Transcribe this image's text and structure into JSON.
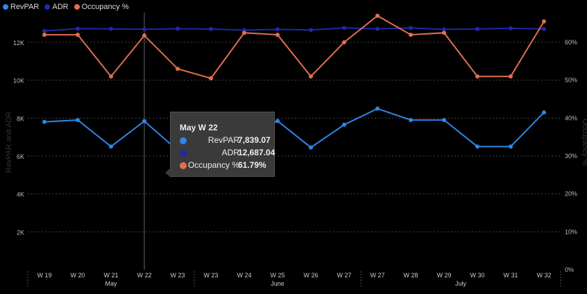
{
  "legend": [
    {
      "name": "RevPAR",
      "color": "#2f86e6"
    },
    {
      "name": "ADR",
      "color": "#1c2aa8"
    },
    {
      "name": "Occupancy %",
      "color": "#e06f4f"
    }
  ],
  "chart_data": {
    "type": "line",
    "categories": [
      "W 19",
      "W 20",
      "W 21",
      "W 22",
      "W 23",
      "W 23",
      "W 24",
      "W 25",
      "W 26",
      "W 27",
      "W 27",
      "W 28",
      "W 29",
      "W 30",
      "W 31",
      "W 32"
    ],
    "months": [
      {
        "label": "May",
        "start": 0,
        "end": 5
      },
      {
        "label": "June",
        "start": 5,
        "end": 10
      },
      {
        "label": "July",
        "start": 10,
        "end": 16
      }
    ],
    "ylabel": "RevPAR and ADR",
    "y2label": "Occupancy %",
    "ylim": [
      0,
      13500
    ],
    "y2lim": [
      0,
      0.675
    ],
    "yticks": [
      {
        "value": 2000,
        "label": "2K"
      },
      {
        "value": 4000,
        "label": "4K"
      },
      {
        "value": 6000,
        "label": "6K"
      },
      {
        "value": 8000,
        "label": "8K"
      },
      {
        "value": 10000,
        "label": "10K"
      },
      {
        "value": 12000,
        "label": "12K"
      }
    ],
    "y2ticks": [
      {
        "value": 0,
        "label": "0%"
      },
      {
        "value": 0.1,
        "label": "10%"
      },
      {
        "value": 0.2,
        "label": "20%"
      },
      {
        "value": 0.3,
        "label": "30%"
      },
      {
        "value": 0.4,
        "label": "40%"
      },
      {
        "value": 0.5,
        "label": "50%"
      },
      {
        "value": 0.6,
        "label": "60%"
      }
    ],
    "grid": true,
    "series": [
      {
        "name": "RevPAR",
        "axis": "left",
        "color": "#2f86e6",
        "values": [
          7800,
          7900,
          6500,
          7839.07,
          6300,
          6600,
          6900,
          7850,
          6450,
          7650,
          8500,
          7900,
          7900,
          6500,
          6500,
          8300
        ]
      },
      {
        "name": "ADR",
        "axis": "left",
        "color": "#1c2aa8",
        "values": [
          12600,
          12720,
          12710,
          12687.04,
          12720,
          12700,
          12640,
          12680,
          12650,
          12760,
          12710,
          12760,
          12680,
          12700,
          12740,
          12700
        ]
      },
      {
        "name": "Occupancy %",
        "axis": "right",
        "color": "#e06f4f",
        "values": [
          0.62,
          0.62,
          0.51,
          0.6179,
          0.53,
          0.505,
          0.625,
          0.62,
          0.51,
          0.6,
          0.67,
          0.62,
          0.625,
          0.51,
          0.51,
          0.655
        ]
      }
    ],
    "highlight_index": 3
  },
  "tooltip": {
    "title": "May W 22",
    "rows": [
      {
        "label": "RevPAR",
        "value": "7,839.07",
        "color": "#2f86e6"
      },
      {
        "label": "ADR",
        "value": "12,687.04",
        "color": "#1c2aa8"
      },
      {
        "label": "Occupancy %",
        "value": "61.79%",
        "color": "#e06f4f"
      }
    ]
  }
}
